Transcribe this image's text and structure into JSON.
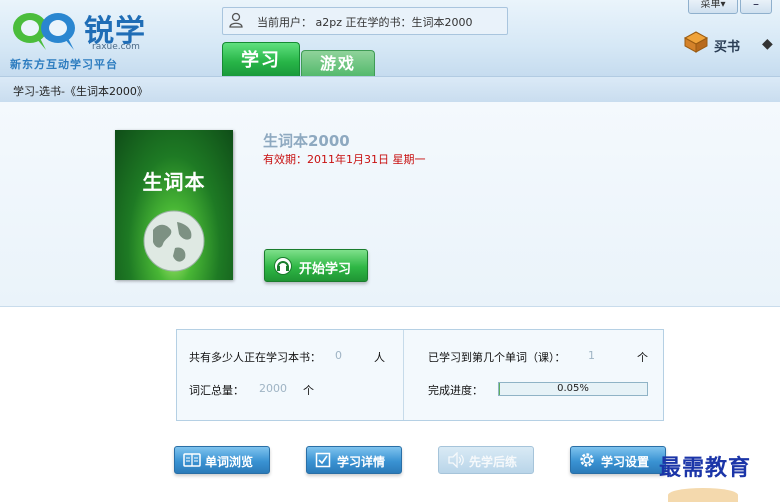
{
  "header": {
    "brand": "锐学",
    "domain": "raxue.com",
    "tagline": "新东方互动学习平台",
    "user_text": "当前用户： a2pz    正在学的书：生词本2000",
    "tabs": [
      {
        "label": "学习",
        "active": true
      },
      {
        "label": "游戏",
        "active": false
      }
    ],
    "menu_label": "菜单▾",
    "minimize_label": "–",
    "buy_label": "买书",
    "icons": {
      "user": "user-icon",
      "buy": "book-cart-icon"
    }
  },
  "breadcrumb": "学习-选书-《生词本2000》",
  "book": {
    "cover_title": "生词本",
    "title": "生词本2000",
    "valid_until": "有效期：2011年1月31日  星期一",
    "start_label": "开始学习"
  },
  "stats": {
    "learners_label": "共有多少人正在学习本书：",
    "learners_value": "0",
    "learners_unit": "人",
    "total_label": "词汇总量：",
    "total_value": "2000",
    "total_unit": "个",
    "current_label": "已学习到第几个单词（课）：",
    "current_value": "1",
    "current_unit": "个",
    "progress_label": "完成进度：",
    "progress_text": "0.05%",
    "progress_fraction": 0.0005
  },
  "actions": [
    {
      "label": "单词浏览",
      "icon": "book-open-icon",
      "enabled": true
    },
    {
      "label": "学习详情",
      "icon": "checklist-icon",
      "enabled": true
    },
    {
      "label": "先学后练",
      "icon": "speaker-icon",
      "enabled": false
    },
    {
      "label": "学习设置",
      "icon": "gear-icon",
      "enabled": true
    }
  ],
  "watermark": "最需教育",
  "colors": {
    "accent_green": "#28b548",
    "accent_blue": "#3a93d3",
    "warning_red": "#c81010"
  }
}
